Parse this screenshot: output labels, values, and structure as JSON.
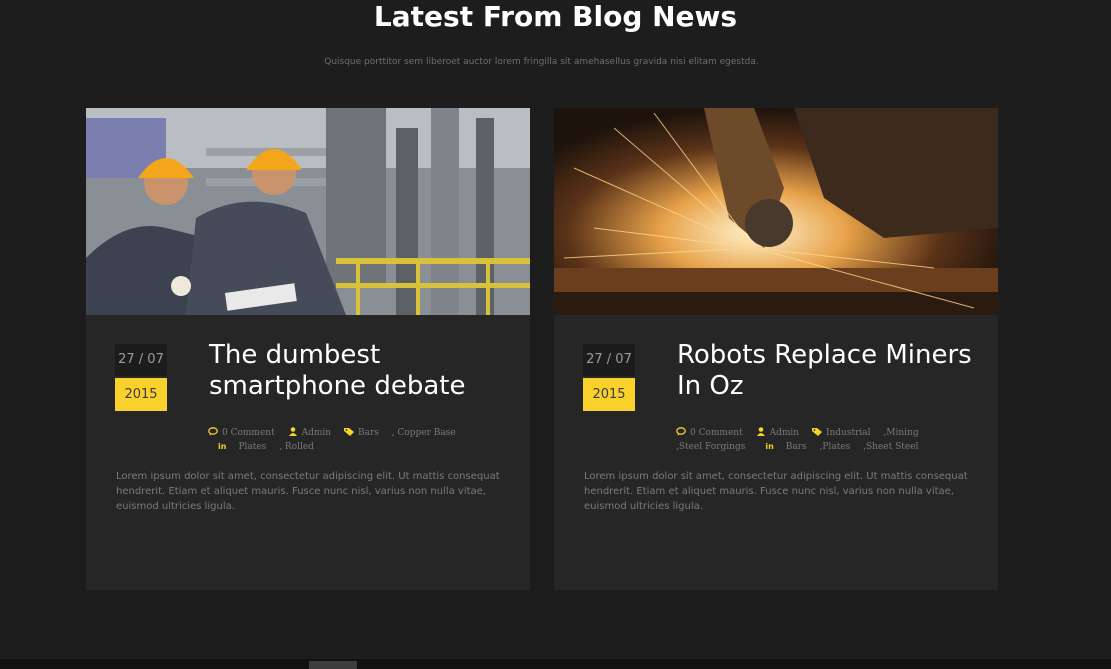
{
  "section": {
    "title": "Latest From Blog News",
    "subtitle": "Quisque porttitor sem liberoet auctor lorem fringilla sit amehasellus gravida nisi elitam egestda."
  },
  "posts": [
    {
      "day": "27 / 07",
      "year": "2015",
      "title": "The dumbest smartphone debate",
      "comments": "0 Comment",
      "author": "Admin",
      "tags_row1": [
        "Bars",
        ", Copper Base"
      ],
      "tags_row2": [
        "Plates",
        ", Rolled"
      ],
      "excerpt": "Lorem ipsum dolor sit amet, consectetur adipiscing elit. Ut mattis consequat hendrerit. Etiam et aliquet mauris. Fusce nunc nisl, varius non nulla vitae, euismod ultricies ligula."
    },
    {
      "day": "27 / 07",
      "year": "2015",
      "title": "Robots Replace Miners In Oz",
      "comments": "0 Comment",
      "author": "Admin",
      "tags_row1": [
        "Industrial",
        ",Mining"
      ],
      "tags_row2": [
        ",Steel Forgings",
        "Bars",
        ",Plates",
        ",Sheet Steel"
      ],
      "excerpt": "Lorem ipsum dolor sit amet, consectetur adipiscing elit. Ut mattis consequat hendrerit. Etiam et aliquet mauris. Fusce nunc nisl, varius non nulla vitae, euismod ultricies ligula."
    }
  ],
  "icons": {
    "comment": "speech-bubble-icon",
    "author": "user-icon",
    "tags": "tag-icon",
    "share": "linkedin-icon"
  },
  "colors": {
    "accent": "#f8d12c",
    "background": "#1d1d1d",
    "card": "#262626"
  }
}
